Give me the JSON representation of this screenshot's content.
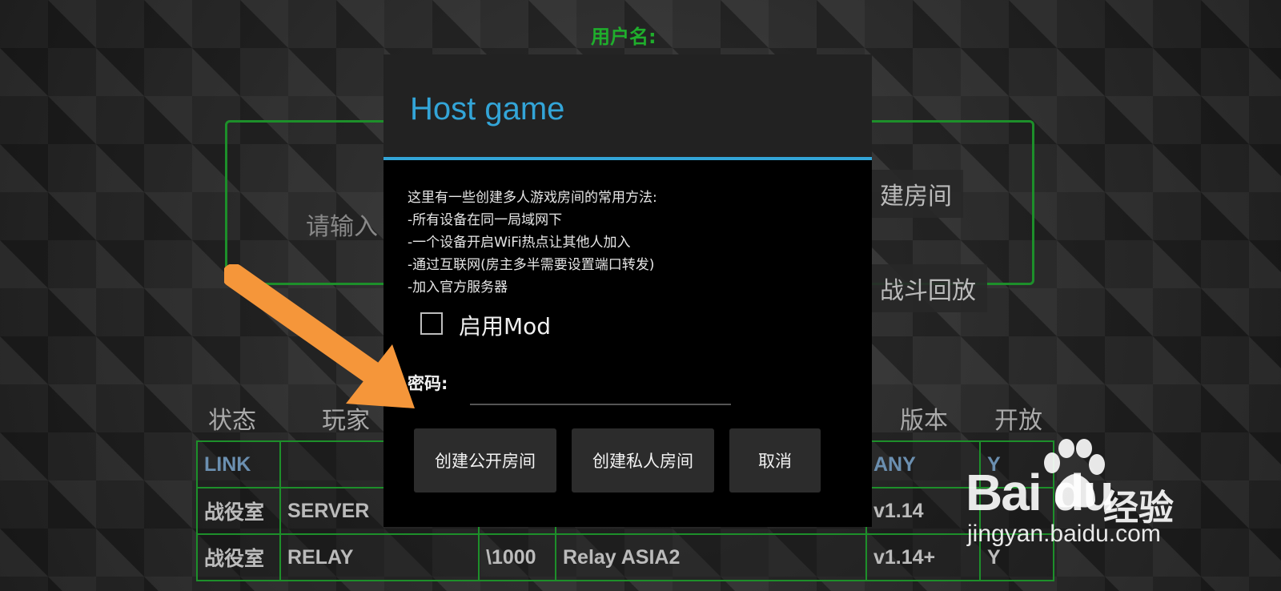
{
  "background": {
    "username_label": "用户名:",
    "name_placeholder": "请输入",
    "create_room_button": "建房间",
    "replay_button": "战斗回放",
    "columns": {
      "status": "状态",
      "players": "玩家",
      "version": "版本",
      "open": "开放"
    },
    "rows": [
      [
        "LINK",
        "",
        "",
        "",
        "ANY",
        "Y"
      ],
      [
        "战役室",
        "SERVER",
        "",
        "",
        "v1.14",
        ""
      ],
      [
        "战役室",
        "RELAY",
        "\\1000",
        "Relay ASIA2",
        "v1.14+",
        "Y"
      ]
    ]
  },
  "dialog": {
    "title": "Host game",
    "body_lines": [
      "这里有一些创建多人游戏房间的常用方法:",
      "-所有设备在同一局域网下",
      "-一个设备开启WiFi热点让其他人加入",
      "-通过互联网(房主多半需要设置端口转发)",
      "-加入官方服务器"
    ],
    "mod_checkbox_label": "启用Mod",
    "mod_checked": false,
    "password_label": "密码:",
    "password_value": "",
    "buttons": {
      "public": "创建公开房间",
      "private": "创建私人房间",
      "cancel": "取消"
    }
  },
  "watermark": {
    "brand": "Bai du",
    "brand_cn": "经验",
    "url": "jingyan.baidu.com"
  },
  "colors": {
    "accent_blue": "#33a5d8",
    "table_green": "#1d8f2a",
    "arrow_orange": "#f5963a"
  }
}
